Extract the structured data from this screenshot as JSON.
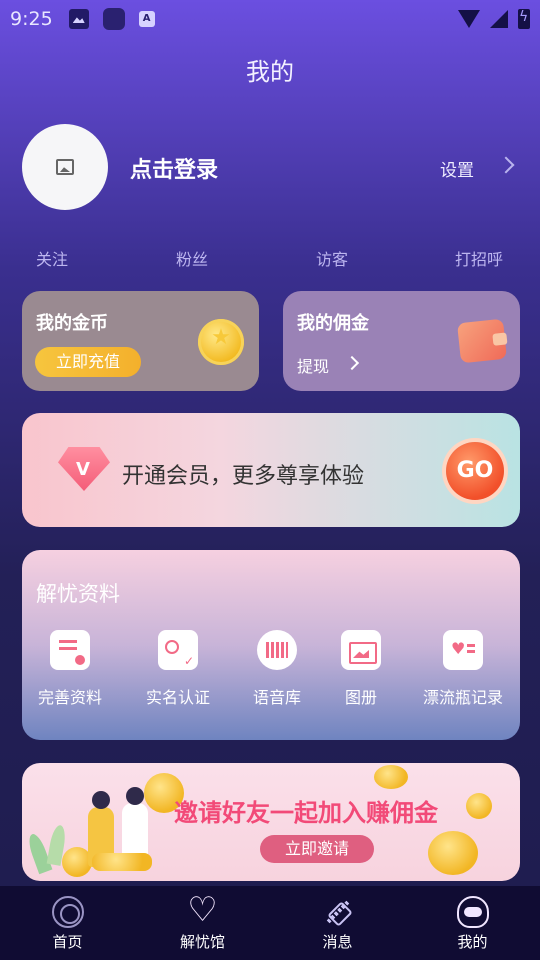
{
  "status_bar": {
    "time": "9:25",
    "icons": [
      "image-icon",
      "app-icon",
      "a-icon",
      "wifi-icon",
      "signal-icon",
      "battery-icon"
    ]
  },
  "header": {
    "title": "我的"
  },
  "profile": {
    "login": "点击登录",
    "settings": "设置",
    "avatar_icon": "image-placeholder-icon"
  },
  "stats": {
    "follow": "关注",
    "fans": "粉丝",
    "visitors": "访客",
    "greet": "打招呼"
  },
  "coins": {
    "title": "我的金币",
    "button": "立即充值",
    "icon": "coin-icon"
  },
  "commission": {
    "title": "我的佣金",
    "link": "提现",
    "icon": "wallet-icon"
  },
  "vip": {
    "text": "开通会员，更多尊享体验",
    "badge": "V",
    "button": "GO"
  },
  "profile_info": {
    "title": "解忧资料",
    "items": [
      {
        "label": "完善资料",
        "icon": "profile-card-icon"
      },
      {
        "label": "实名认证",
        "icon": "id-verify-icon"
      },
      {
        "label": "语音库",
        "icon": "voice-wave-icon"
      },
      {
        "label": "图册",
        "icon": "album-icon"
      },
      {
        "label": "漂流瓶记录",
        "icon": "bottle-record-icon"
      }
    ]
  },
  "invite": {
    "title": "邀请好友一起加入赚佣金",
    "button": "立即邀请"
  },
  "tabbar": {
    "items": [
      {
        "label": "首页",
        "icon": "home-icon"
      },
      {
        "label": "解忧馆",
        "icon": "heart-icon"
      },
      {
        "label": "消息",
        "icon": "satellite-icon"
      },
      {
        "label": "我的",
        "icon": "astronaut-icon"
      }
    ]
  },
  "colors": {
    "accent_pink": "#f24a78",
    "recharge_yellow": "#f6c53e",
    "tabbar_bg": "#100c33"
  }
}
